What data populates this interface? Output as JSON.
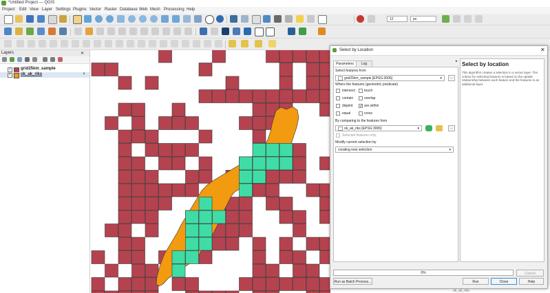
{
  "window": {
    "title": "*Untitled Project — QGIS"
  },
  "menubar": [
    "Project",
    "Edit",
    "View",
    "Layer",
    "Settings",
    "Plugins",
    "Vector",
    "Raster",
    "Database",
    "Web",
    "Mesh",
    "Processing",
    "Help"
  ],
  "toolbar": {
    "scale_value": "12",
    "unit_value": "px"
  },
  "layers_panel": {
    "title": "Layers",
    "layers": [
      {
        "name": "grid25km_sample",
        "checked": true,
        "color": "#b5434f"
      },
      {
        "name": "ok_ak_riks",
        "checked": true,
        "color": "#f29a10"
      }
    ]
  },
  "dialog": {
    "title": "Select by Location",
    "tabs": [
      "Parameters",
      "Log"
    ],
    "select_features_from_label": "Select features from",
    "select_features_from_value": "grid25km_sample [EPSG:3006]",
    "predicate_label": "Where the features (geometric predicate)",
    "predicates": [
      {
        "label": "intersect",
        "checked": false
      },
      {
        "label": "touch",
        "checked": false
      },
      {
        "label": "contain",
        "checked": false
      },
      {
        "label": "overlap",
        "checked": false
      },
      {
        "label": "disjoint",
        "checked": false
      },
      {
        "label": "are within",
        "checked": true
      },
      {
        "label": "equal",
        "checked": false
      },
      {
        "label": "cross",
        "checked": false
      }
    ],
    "compare_label": "By comparing to the features from",
    "compare_value": "ok_ak_riks [EPSG:3006]",
    "selected_only_label": "Selected features only",
    "modify_label": "Modify current selection by",
    "modify_value": "creating new selection",
    "help_title": "Select by location",
    "help_text": "This algorithm creates a selection in a vector layer. The criteria for selecting features is based on the spatial relationship between each feature and the features in an additional layer.",
    "progress_text": "0%",
    "cancel_label": "Cancel",
    "batch_label": "Run as Batch Process...",
    "run_label": "Run",
    "close_label": "Close",
    "help_label": "Help"
  },
  "background_panel": {
    "item1": "grid25km_sample",
    "item2": "ok_ak_riks"
  },
  "colors": {
    "grid_cell": "#b5434f",
    "polygon": "#f29a10",
    "selected_cell": "#3fdca6",
    "outline": "#333333"
  },
  "map_cells": {
    "red": [
      [
        0,
        1
      ],
      [
        5,
        0
      ],
      [
        9,
        0
      ],
      [
        13,
        0
      ],
      [
        14,
        0
      ],
      [
        15,
        0
      ],
      [
        16,
        0
      ],
      [
        17,
        0
      ],
      [
        1,
        1
      ],
      [
        8,
        1
      ],
      [
        14,
        1
      ],
      [
        16,
        1
      ],
      [
        17,
        1
      ],
      [
        2,
        2
      ],
      [
        4,
        2
      ],
      [
        10,
        2
      ],
      [
        14,
        2
      ],
      [
        16,
        2
      ],
      [
        17,
        2
      ],
      [
        8,
        3
      ],
      [
        9,
        3
      ],
      [
        10,
        3
      ],
      [
        11,
        3
      ],
      [
        12,
        3
      ],
      [
        13,
        3
      ],
      [
        14,
        3
      ],
      [
        15,
        3
      ],
      [
        16,
        3
      ],
      [
        17,
        3
      ],
      [
        2,
        4
      ],
      [
        3,
        4
      ],
      [
        6,
        4
      ],
      [
        12,
        4
      ],
      [
        13,
        4
      ],
      [
        14,
        4
      ],
      [
        17,
        4
      ],
      [
        1,
        5
      ],
      [
        3,
        5
      ],
      [
        5,
        5
      ],
      [
        6,
        5
      ],
      [
        7,
        5
      ],
      [
        11,
        5
      ],
      [
        12,
        5
      ],
      [
        13,
        5
      ],
      [
        2,
        6
      ],
      [
        3,
        6
      ],
      [
        4,
        6
      ],
      [
        8,
        6
      ],
      [
        12,
        6
      ],
      [
        2,
        7
      ],
      [
        4,
        7
      ],
      [
        5,
        7
      ],
      [
        6,
        7
      ],
      [
        7,
        7
      ],
      [
        14,
        7
      ],
      [
        15,
        7
      ],
      [
        2,
        8
      ],
      [
        3,
        8
      ],
      [
        5,
        8
      ],
      [
        6,
        8
      ],
      [
        8,
        8
      ],
      [
        11,
        8
      ],
      [
        14,
        8
      ],
      [
        15,
        8
      ],
      [
        17,
        8
      ],
      [
        2,
        9
      ],
      [
        3,
        9
      ],
      [
        4,
        9
      ],
      [
        7,
        9
      ],
      [
        8,
        9
      ],
      [
        10,
        9
      ],
      [
        11,
        9
      ],
      [
        12,
        9
      ],
      [
        13,
        9
      ],
      [
        14,
        9
      ],
      [
        15,
        9
      ],
      [
        2,
        10
      ],
      [
        3,
        10
      ],
      [
        4,
        10
      ],
      [
        5,
        10
      ],
      [
        6,
        10
      ],
      [
        7,
        10
      ],
      [
        12,
        10
      ],
      [
        13,
        10
      ],
      [
        16,
        10
      ],
      [
        17,
        10
      ],
      [
        2,
        11
      ],
      [
        3,
        11
      ],
      [
        4,
        11
      ],
      [
        5,
        11
      ],
      [
        9,
        11
      ],
      [
        10,
        11
      ],
      [
        11,
        11
      ],
      [
        13,
        11
      ],
      [
        14,
        11
      ],
      [
        17,
        11
      ],
      [
        2,
        12
      ],
      [
        3,
        12
      ],
      [
        4,
        12
      ],
      [
        7,
        12
      ],
      [
        10,
        12
      ],
      [
        11,
        12
      ],
      [
        14,
        12
      ],
      [
        15,
        12
      ],
      [
        17,
        12
      ],
      [
        1,
        13
      ],
      [
        2,
        13
      ],
      [
        4,
        13
      ],
      [
        9,
        13
      ],
      [
        10,
        13
      ],
      [
        11,
        13
      ],
      [
        15,
        13
      ],
      [
        2,
        14
      ],
      [
        3,
        14
      ],
      [
        9,
        14
      ],
      [
        10,
        14
      ],
      [
        12,
        14
      ],
      [
        14,
        14
      ],
      [
        16,
        14
      ],
      [
        17,
        14
      ],
      [
        0,
        15
      ],
      [
        2,
        15
      ],
      [
        3,
        15
      ],
      [
        5,
        15
      ],
      [
        6,
        15
      ],
      [
        8,
        15
      ],
      [
        12,
        15
      ],
      [
        14,
        15
      ],
      [
        15,
        15
      ],
      [
        17,
        15
      ],
      [
        1,
        16
      ],
      [
        3,
        16
      ],
      [
        4,
        16
      ],
      [
        12,
        16
      ],
      [
        13,
        16
      ],
      [
        15,
        16
      ],
      [
        16,
        16
      ],
      [
        0,
        17
      ],
      [
        2,
        17
      ],
      [
        3,
        17
      ],
      [
        4,
        17
      ],
      [
        6,
        17
      ],
      [
        7,
        17
      ],
      [
        11,
        17
      ],
      [
        12,
        17
      ],
      [
        13,
        17
      ],
      [
        14,
        17
      ],
      [
        15,
        17
      ],
      [
        16,
        17
      ],
      [
        17,
        17
      ],
      [
        0,
        18
      ],
      [
        1,
        18
      ],
      [
        2,
        18
      ],
      [
        3,
        18
      ],
      [
        4,
        18
      ],
      [
        7,
        18
      ],
      [
        8,
        18
      ],
      [
        9,
        18
      ],
      [
        10,
        18
      ],
      [
        12,
        18
      ],
      [
        13,
        18
      ],
      [
        16,
        18
      ],
      [
        17,
        18
      ]
    ],
    "green": [
      [
        12,
        7
      ],
      [
        13,
        7
      ],
      [
        14,
        7
      ],
      [
        11,
        8
      ],
      [
        12,
        8
      ],
      [
        13,
        8
      ],
      [
        14,
        8
      ],
      [
        11,
        9
      ],
      [
        12,
        9
      ],
      [
        11,
        10
      ],
      [
        8,
        11
      ],
      [
        7,
        12
      ],
      [
        8,
        12
      ],
      [
        9,
        12
      ],
      [
        7,
        13
      ],
      [
        8,
        13
      ],
      [
        7,
        14
      ],
      [
        8,
        14
      ],
      [
        6,
        15
      ],
      [
        7,
        15
      ],
      [
        6,
        16
      ]
    ]
  }
}
